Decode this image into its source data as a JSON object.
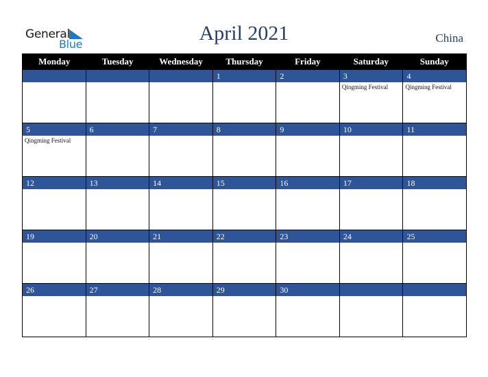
{
  "brand": {
    "line1": "General",
    "line2": "Blue",
    "accent": "#1f78c1"
  },
  "title": "April 2021",
  "country": "China",
  "colors": {
    "header_bg": "#000000",
    "day_bar": "#2e5597",
    "title": "#243f6b"
  },
  "weekdays": [
    "Monday",
    "Tuesday",
    "Wednesday",
    "Thursday",
    "Friday",
    "Saturday",
    "Sunday"
  ],
  "weeks": [
    [
      {
        "day": "",
        "event": ""
      },
      {
        "day": "",
        "event": ""
      },
      {
        "day": "",
        "event": ""
      },
      {
        "day": "1",
        "event": ""
      },
      {
        "day": "2",
        "event": ""
      },
      {
        "day": "3",
        "event": "Qingming Festival"
      },
      {
        "day": "4",
        "event": "Qingming Festival"
      }
    ],
    [
      {
        "day": "5",
        "event": "Qingming Festival"
      },
      {
        "day": "6",
        "event": ""
      },
      {
        "day": "7",
        "event": ""
      },
      {
        "day": "8",
        "event": ""
      },
      {
        "day": "9",
        "event": ""
      },
      {
        "day": "10",
        "event": ""
      },
      {
        "day": "11",
        "event": ""
      }
    ],
    [
      {
        "day": "12",
        "event": ""
      },
      {
        "day": "13",
        "event": ""
      },
      {
        "day": "14",
        "event": ""
      },
      {
        "day": "15",
        "event": ""
      },
      {
        "day": "16",
        "event": ""
      },
      {
        "day": "17",
        "event": ""
      },
      {
        "day": "18",
        "event": ""
      }
    ],
    [
      {
        "day": "19",
        "event": ""
      },
      {
        "day": "20",
        "event": ""
      },
      {
        "day": "21",
        "event": ""
      },
      {
        "day": "22",
        "event": ""
      },
      {
        "day": "23",
        "event": ""
      },
      {
        "day": "24",
        "event": ""
      },
      {
        "day": "25",
        "event": ""
      }
    ],
    [
      {
        "day": "26",
        "event": ""
      },
      {
        "day": "27",
        "event": ""
      },
      {
        "day": "28",
        "event": ""
      },
      {
        "day": "29",
        "event": ""
      },
      {
        "day": "30",
        "event": ""
      },
      {
        "day": "",
        "event": ""
      },
      {
        "day": "",
        "event": ""
      }
    ]
  ]
}
